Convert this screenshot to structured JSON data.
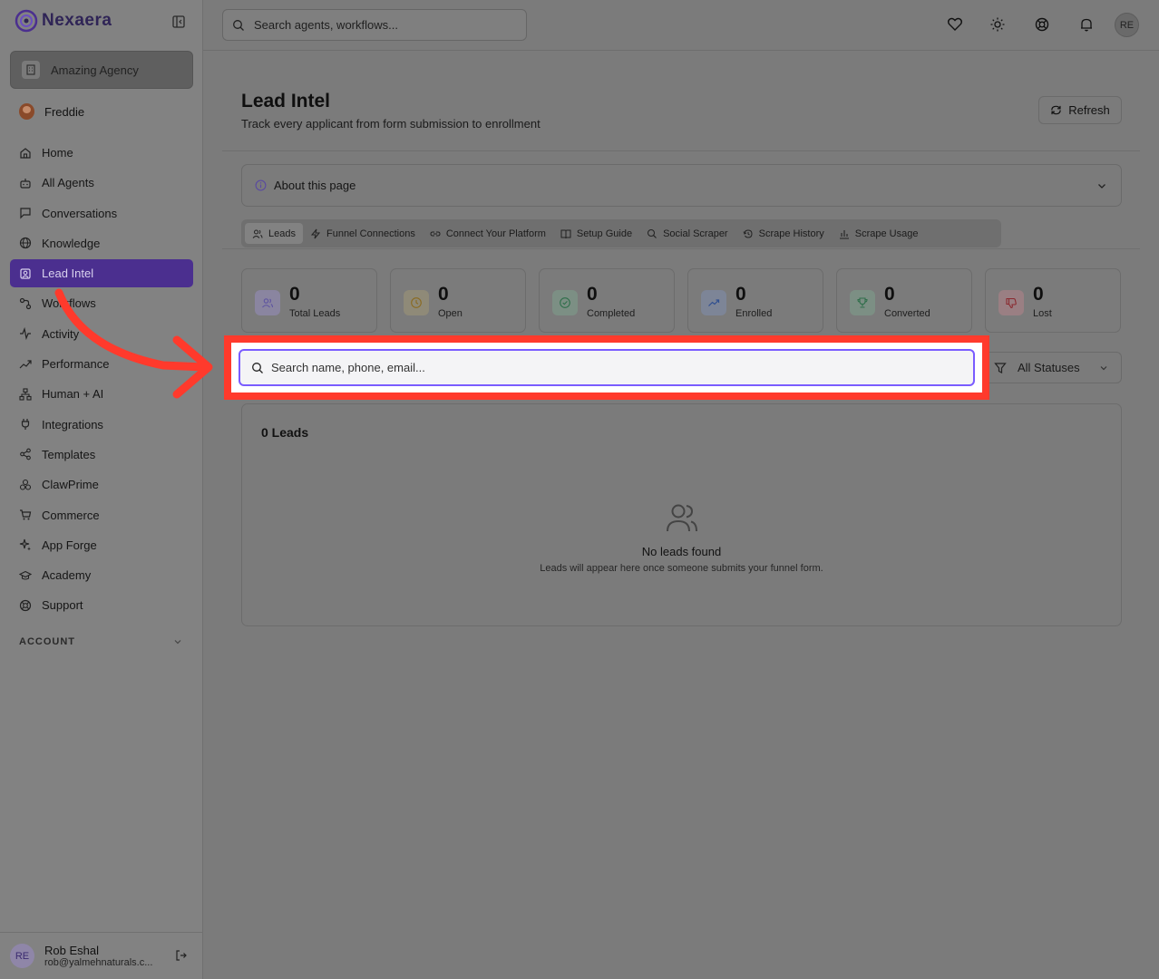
{
  "brand": {
    "name": "Nexaera"
  },
  "sidebar": {
    "agency": "Amazing Agency",
    "user": "Freddie",
    "items": [
      {
        "label": "Home",
        "icon": "home-icon"
      },
      {
        "label": "All Agents",
        "icon": "bot-icon"
      },
      {
        "label": "Conversations",
        "icon": "chat-icon"
      },
      {
        "label": "Knowledge",
        "icon": "globe-icon"
      },
      {
        "label": "Lead Intel",
        "icon": "contact-icon",
        "active": true
      },
      {
        "label": "Workflows",
        "icon": "workflow-icon"
      },
      {
        "label": "Activity",
        "icon": "activity-icon"
      },
      {
        "label": "Performance",
        "icon": "trend-icon"
      },
      {
        "label": "Human + AI",
        "icon": "network-icon"
      },
      {
        "label": "Integrations",
        "icon": "plug-icon"
      },
      {
        "label": "Templates",
        "icon": "share-icon"
      },
      {
        "label": "ClawPrime",
        "icon": "cluster-icon"
      },
      {
        "label": "Commerce",
        "icon": "cart-icon"
      },
      {
        "label": "App Forge",
        "icon": "sparkle-icon"
      },
      {
        "label": "Academy",
        "icon": "graduation-icon"
      },
      {
        "label": "Support",
        "icon": "lifebuoy-icon"
      }
    ],
    "account_label": "ACCOUNT",
    "footer": {
      "initials": "RE",
      "name": "Rob Eshal",
      "email": "rob@yalmehnaturals.c..."
    }
  },
  "topbar": {
    "search_placeholder": "Search agents, workflows...",
    "avatar_initials": "RE"
  },
  "page": {
    "title": "Lead Intel",
    "subtitle": "Track every applicant from form submission to enrollment",
    "refresh_label": "Refresh",
    "about_label": "About this page"
  },
  "tabs": [
    {
      "label": "Leads",
      "active": true
    },
    {
      "label": "Funnel Connections"
    },
    {
      "label": "Connect Your Platform"
    },
    {
      "label": "Setup Guide"
    },
    {
      "label": "Social Scraper"
    },
    {
      "label": "Scrape History"
    },
    {
      "label": "Scrape Usage"
    }
  ],
  "stats": [
    {
      "value": "0",
      "label": "Total Leads",
      "color": "#8b83b8"
    },
    {
      "value": "0",
      "label": "Open",
      "color": "#9a8a5c"
    },
    {
      "value": "0",
      "label": "Completed",
      "color": "#6c9a7f"
    },
    {
      "value": "0",
      "label": "Enrolled",
      "color": "#6f82a8"
    },
    {
      "value": "0",
      "label": "Converted",
      "color": "#6c9a7f"
    },
    {
      "value": "0",
      "label": "Lost",
      "color": "#b07a7f"
    }
  ],
  "filters": {
    "search_placeholder": "Search name, phone, email...",
    "status_value": "All Statuses"
  },
  "leads": {
    "count_label": "0 Leads",
    "empty_title": "No leads found",
    "empty_sub": "Leads will appear here once someone submits your funnel form."
  }
}
